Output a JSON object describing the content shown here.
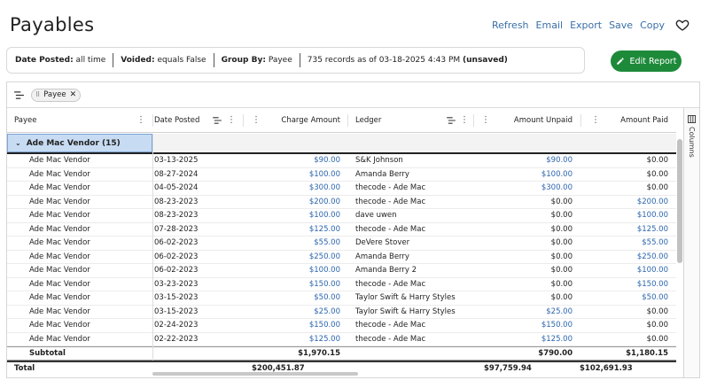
{
  "page": {
    "title": "Payables"
  },
  "actions": [
    "Refresh",
    "Email",
    "Export",
    "Save",
    "Copy"
  ],
  "filters": {
    "date_posted_label": "Date Posted:",
    "date_posted_value": "all time",
    "voided_label": "Voided:",
    "voided_value": "equals False",
    "group_by_label": "Group By:",
    "group_by_value": "Payee",
    "records": "735 records as of 03-18-2025 4:43 PM",
    "unsaved": "(unsaved)"
  },
  "edit_button": "Edit Report",
  "group_chip": "Payee",
  "columns": {
    "payee": "Payee",
    "date_posted": "Date Posted",
    "charge_amount": "Charge Amount",
    "ledger": "Ledger",
    "amount_unpaid": "Amount Unpaid",
    "amount_paid": "Amount Paid"
  },
  "side_panel": "Columns",
  "group": {
    "label": "Ade Mac Vendor (15)"
  },
  "rows": [
    {
      "payee": "Ade Mac Vendor",
      "date": "03-13-2025",
      "charge": "$90.00",
      "ledger": "S&K Johnson",
      "unpaid": "$90.00",
      "paid": "$0.00"
    },
    {
      "payee": "Ade Mac Vendor",
      "date": "08-27-2024",
      "charge": "$100.00",
      "ledger": "Amanda Berry",
      "unpaid": "$100.00",
      "paid": "$0.00"
    },
    {
      "payee": "Ade Mac Vendor",
      "date": "04-05-2024",
      "charge": "$300.00",
      "ledger": "thecode - Ade Mac",
      "unpaid": "$300.00",
      "paid": "$0.00"
    },
    {
      "payee": "Ade Mac Vendor",
      "date": "08-23-2023",
      "charge": "$200.00",
      "ledger": "thecode - Ade Mac",
      "unpaid": "$0.00",
      "paid": "$200.00"
    },
    {
      "payee": "Ade Mac Vendor",
      "date": "08-23-2023",
      "charge": "$100.00",
      "ledger": "dave uwen",
      "unpaid": "$0.00",
      "paid": "$100.00"
    },
    {
      "payee": "Ade Mac Vendor",
      "date": "07-28-2023",
      "charge": "$125.00",
      "ledger": "thecode - Ade Mac",
      "unpaid": "$0.00",
      "paid": "$125.00"
    },
    {
      "payee": "Ade Mac Vendor",
      "date": "06-02-2023",
      "charge": "$55.00",
      "ledger": "DeVere Stover",
      "unpaid": "$0.00",
      "paid": "$55.00"
    },
    {
      "payee": "Ade Mac Vendor",
      "date": "06-02-2023",
      "charge": "$250.00",
      "ledger": "Amanda Berry",
      "unpaid": "$0.00",
      "paid": "$250.00"
    },
    {
      "payee": "Ade Mac Vendor",
      "date": "06-02-2023",
      "charge": "$100.00",
      "ledger": "Amanda Berry 2",
      "unpaid": "$0.00",
      "paid": "$100.00"
    },
    {
      "payee": "Ade Mac Vendor",
      "date": "03-23-2023",
      "charge": "$150.00",
      "ledger": "thecode - Ade Mac",
      "unpaid": "$0.00",
      "paid": "$150.00"
    },
    {
      "payee": "Ade Mac Vendor",
      "date": "03-15-2023",
      "charge": "$50.00",
      "ledger": "Taylor Swift & Harry Styles",
      "unpaid": "$0.00",
      "paid": "$50.00"
    },
    {
      "payee": "Ade Mac Vendor",
      "date": "03-15-2023",
      "charge": "$25.00",
      "ledger": "Taylor Swift & Harry Styles",
      "unpaid": "$25.00",
      "paid": "$0.00"
    },
    {
      "payee": "Ade Mac Vendor",
      "date": "02-24-2023",
      "charge": "$150.00",
      "ledger": "thecode - Ade Mac",
      "unpaid": "$150.00",
      "paid": "$0.00"
    },
    {
      "payee": "Ade Mac Vendor",
      "date": "02-22-2023",
      "charge": "$125.00",
      "ledger": "thecode - Ade Mac",
      "unpaid": "$125.00",
      "paid": "$0.00"
    }
  ],
  "subtotal": {
    "label": "Subtotal",
    "charge": "$1,970.15",
    "unpaid": "$790.00",
    "paid": "$1,180.15"
  },
  "total": {
    "label": "Total",
    "charge": "$200,451.87",
    "unpaid": "$97,759.94",
    "paid": "$102,691.93"
  },
  "colors": {
    "accent": "#3a6fa8",
    "button": "#1d8a3a",
    "link_value": "#2c65ad",
    "group_highlight": "#c7dcf3"
  }
}
